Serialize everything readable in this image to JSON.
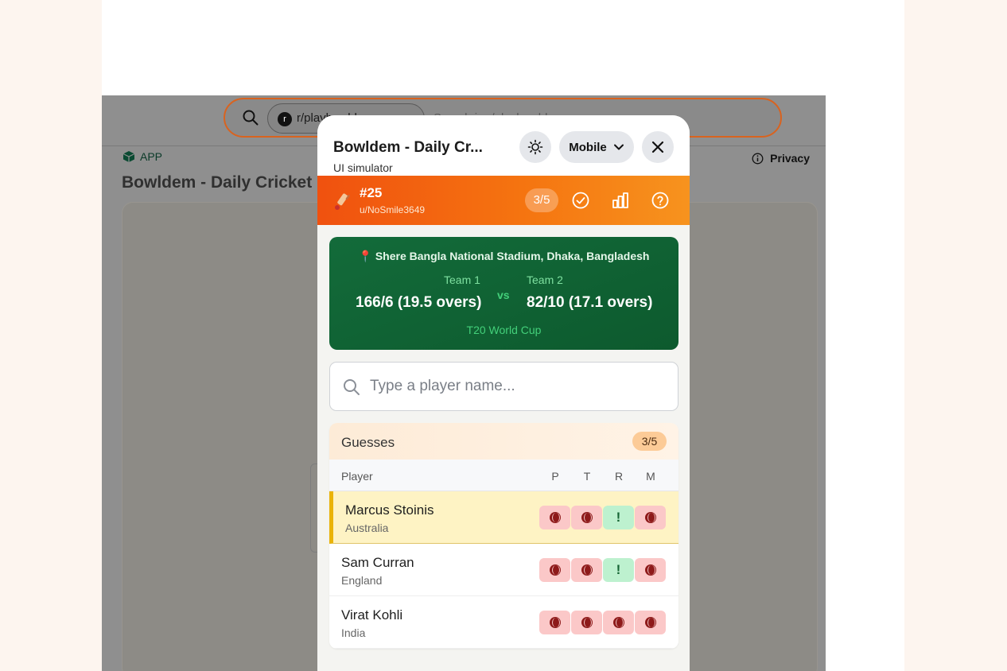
{
  "background": {
    "subreddit_chip": "r/playbowldem",
    "search_placeholder": "Search in r/playbowldem",
    "app_label": "APP",
    "privacy_label": "Privacy",
    "page_title": "Bowldem - Daily Cricket"
  },
  "modal": {
    "title": "Bowldem - Daily Cr...",
    "subtitle": "UI simulator",
    "mode_label": "Mobile"
  },
  "puzzle": {
    "number": "#25",
    "user": "u/NoSmile3649",
    "score": "3/5"
  },
  "match": {
    "venue": "📍 Shere Bangla National Stadium, Dhaka, Bangladesh",
    "team1_label": "Team 1",
    "team1_score": "166/6 (19.5 overs)",
    "vs": "vs",
    "team2_label": "Team 2",
    "team2_score": "82/10 (17.1 overs)",
    "tournament": "T20 World Cup"
  },
  "search": {
    "placeholder": "Type a player name..."
  },
  "guesses": {
    "title": "Guesses",
    "count": "3/5",
    "col_player": "Player",
    "col_p": "P",
    "col_t": "T",
    "col_r": "R",
    "col_m": "M",
    "rows": [
      {
        "name": "Marcus Stoinis",
        "country": "Australia",
        "results": [
          "wrong",
          "wrong",
          "close",
          "wrong"
        ]
      },
      {
        "name": "Sam Curran",
        "country": "England",
        "results": [
          "wrong",
          "wrong",
          "close",
          "wrong"
        ]
      },
      {
        "name": "Virat Kohli",
        "country": "India",
        "results": [
          "wrong",
          "wrong",
          "wrong",
          "wrong"
        ]
      }
    ]
  },
  "colors": {
    "accent_orange": "#f57410",
    "match_green": "#0d5a2e",
    "wrong_red": "#fbc8c8",
    "close_green": "#bdf1cf",
    "highlight_yellow": "#fef3c4"
  }
}
